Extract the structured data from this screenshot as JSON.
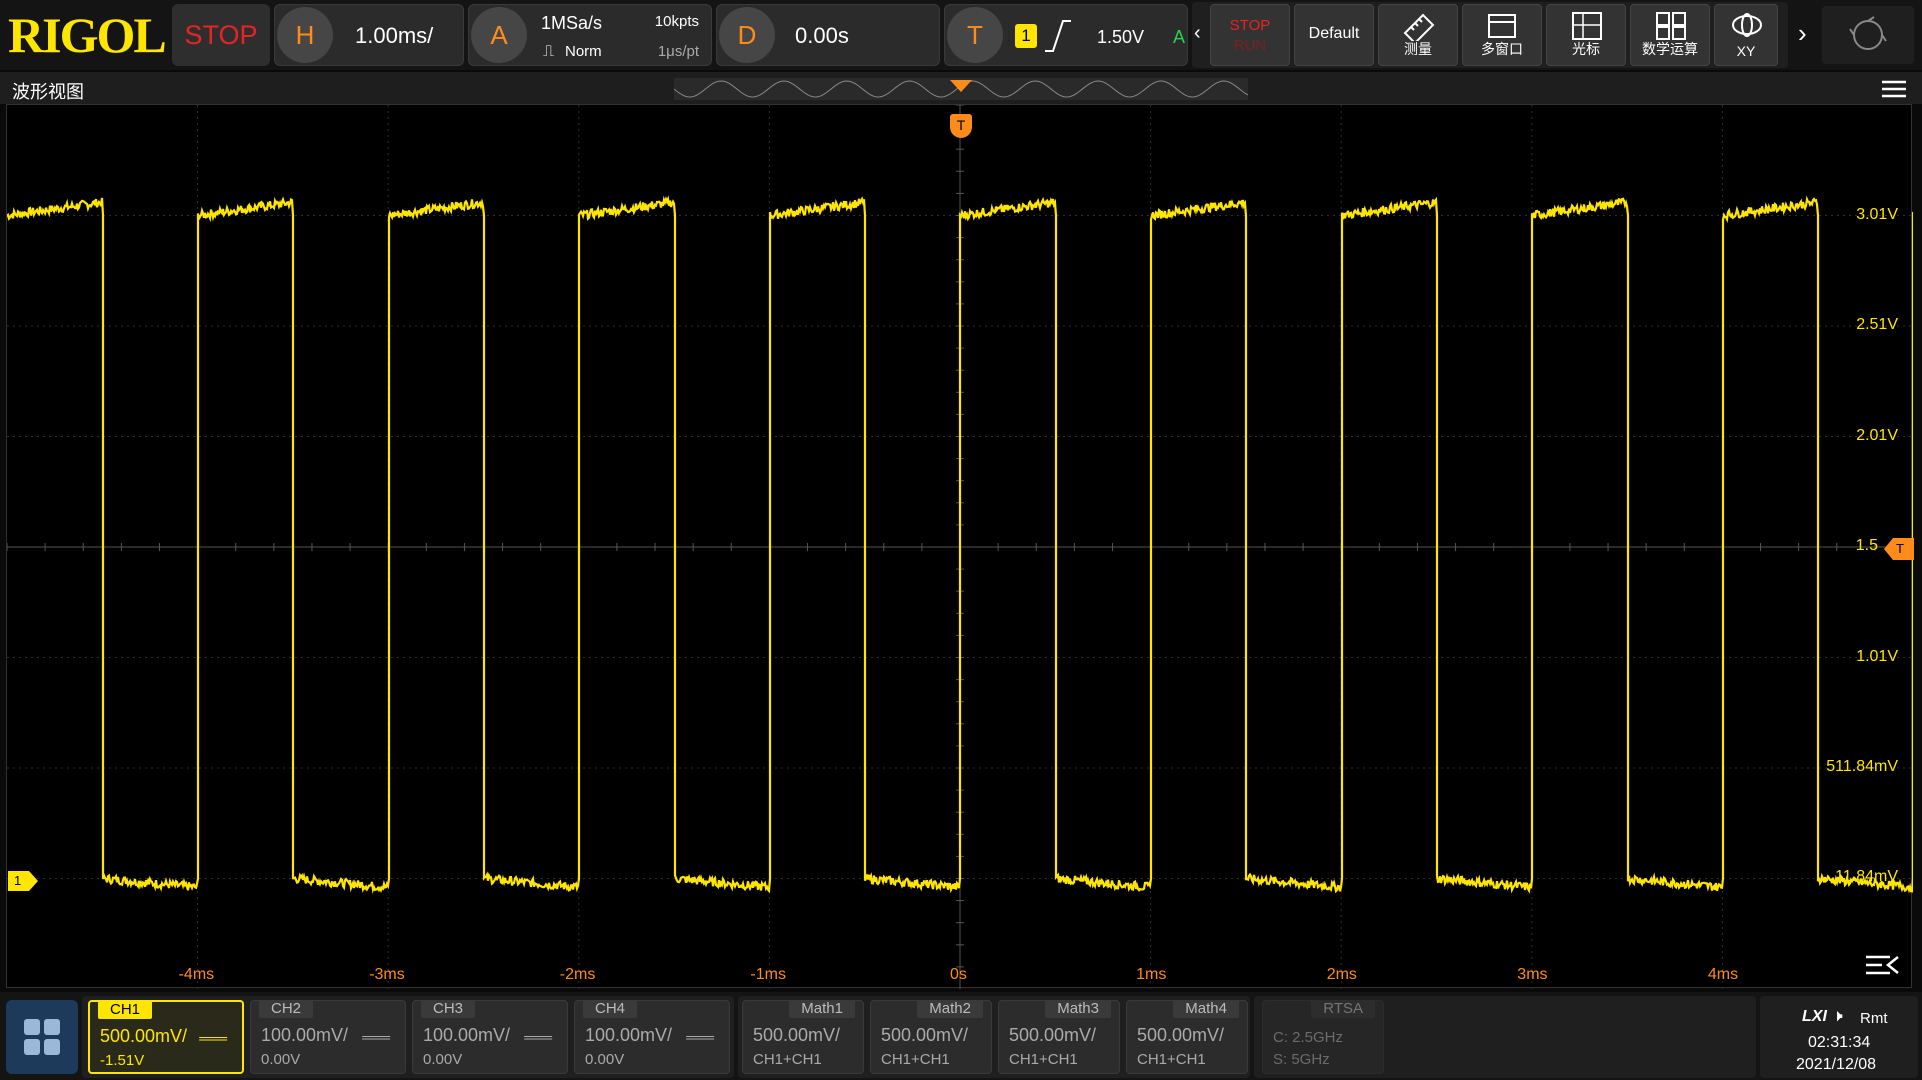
{
  "brand": {
    "logo": "RIGOL"
  },
  "run_state": "STOP",
  "horizontal": {
    "badge": "H",
    "timebase": "1.00ms/"
  },
  "acquire": {
    "badge": "A",
    "sample_rate": "1MSa/s",
    "memory_depth": "10kpts",
    "mode": "Norm",
    "resolution": "1μs/pt"
  },
  "delay": {
    "badge": "D",
    "offset": "0.00s"
  },
  "trigger": {
    "badge": "T",
    "source": "1",
    "level": "1.50V",
    "status": "A",
    "marker": "T"
  },
  "toolbar": {
    "stop_label": "STOP",
    "run_label": "RUN",
    "default_label": "Default",
    "measure_label": "测量",
    "multiwindow_label": "多窗口",
    "cursor_label": "光标",
    "math_label": "数学运算",
    "xy_label": "XY"
  },
  "window_title": "波形视图",
  "right_labels": [
    "3.01V",
    "2.51V",
    "2.01V",
    "1.5",
    "1.01V",
    "511.84mV",
    "11.84mV"
  ],
  "time_labels": [
    "-4ms",
    "-3ms",
    "-2ms",
    "-1ms",
    "0s",
    "1ms",
    "2ms",
    "3ms",
    "4ms"
  ],
  "channel_marker": "1",
  "channels": [
    {
      "name": "CH1",
      "scale": "500.00mV/",
      "offset": "-1.51V"
    },
    {
      "name": "CH2",
      "scale": "100.00mV/",
      "offset": "0.00V"
    },
    {
      "name": "CH3",
      "scale": "100.00mV/",
      "offset": "0.00V"
    },
    {
      "name": "CH4",
      "scale": "100.00mV/",
      "offset": "0.00V"
    }
  ],
  "maths": [
    {
      "name": "Math1",
      "scale": "500.00mV/",
      "expr": "CH1+CH1"
    },
    {
      "name": "Math2",
      "scale": "500.00mV/",
      "expr": "CH1+CH1"
    },
    {
      "name": "Math3",
      "scale": "500.00mV/",
      "expr": "CH1+CH1"
    },
    {
      "name": "Math4",
      "scale": "500.00mV/",
      "expr": "CH1+CH1"
    }
  ],
  "rtsa": {
    "name": "RTSA",
    "center": "C: 2.5GHz",
    "span": "S: 5GHz"
  },
  "status": {
    "lxi": "LXI",
    "remote": "Rmt",
    "time": "02:31:34",
    "date": "2021/12/08"
  },
  "colors": {
    "ch1": "#ffe600",
    "trigger": "#ff8c1a",
    "stop": "#e82323"
  },
  "waveform": {
    "high_v": 3.01,
    "low_v": 0.01,
    "period_ms": 1.0,
    "rising_edge_ms": 0.0
  }
}
